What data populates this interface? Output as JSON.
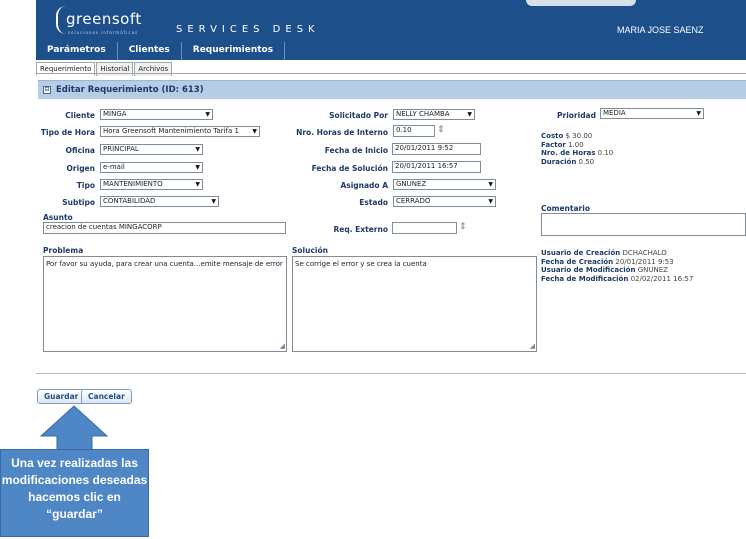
{
  "header": {
    "logo_text": "greensoft",
    "logo_sub": "soluciones informáticas",
    "services_title": "SERVICES DESK",
    "user_name": "MARIA JOSE SAENZ"
  },
  "nav": {
    "items": [
      "Parámetros",
      "Clientes",
      "Requerimientos"
    ]
  },
  "tabs": [
    "Requerimiento",
    "Historial",
    "Archivos"
  ],
  "panel_title": "Editar Requerimiento (ID: 613)",
  "form": {
    "cliente": {
      "label": "Cliente",
      "value": "MINGA"
    },
    "tipo_hora": {
      "label": "Tipo de Hora",
      "value": "Hora Greensoft Mantenimiento Tarifa 1"
    },
    "oficina": {
      "label": "Oficina",
      "value": "PRINCIPAL"
    },
    "origen": {
      "label": "Origen",
      "value": "e-mail"
    },
    "tipo": {
      "label": "Tipo",
      "value": "MANTENIMIENTO"
    },
    "subtipo": {
      "label": "Subtipo",
      "value": "CONTABILIDAD"
    },
    "solicitado_por": {
      "label": "Solicitado Por",
      "value": "NELLY CHAMBA"
    },
    "nro_horas_interno": {
      "label": "Nro. Horas de Interno",
      "value": "0.10"
    },
    "fecha_inicio": {
      "label": "Fecha de Inicio",
      "value": "20/01/2011 9:52"
    },
    "fecha_solucion": {
      "label": "Fecha de Solución",
      "value": "20/01/2011 16:57"
    },
    "asignado_a": {
      "label": "Asignado A",
      "value": "GNUNEZ"
    },
    "estado": {
      "label": "Estado",
      "value": "CERRADO"
    },
    "prioridad": {
      "label": "Prioridad",
      "value": "MEDIA"
    },
    "asunto": {
      "label": "Asunto",
      "value": "creacion de cuentas MINGACORP"
    },
    "req_externo": {
      "label": "Req. Externo",
      "value": ""
    },
    "problema": {
      "label": "Problema",
      "value": "Por favor su ayuda, para crear una cuenta...emite mensaje de error"
    },
    "solucion": {
      "label": "Solución",
      "value": "Se corrige el error y se crea la cuenta"
    },
    "comentario": {
      "label": "Comentario",
      "value": ""
    }
  },
  "summary": {
    "costo_label": "Costo",
    "costo_value": "$ 30.00",
    "factor_label": "Factor",
    "factor_value": "1.00",
    "nro_horas_label": "Nro. de Horas",
    "nro_horas_value": "0.10",
    "duracion_label": "Duración",
    "duracion_value": "0.50"
  },
  "audit": {
    "usuario_creacion_label": "Usuario de Creación",
    "usuario_creacion_value": "DCHACHALO",
    "fecha_creacion_label": "Fecha de Creación",
    "fecha_creacion_value": "20/01/2011 9:53",
    "usuario_modificacion_label": "Usuario de Modificación",
    "usuario_modificacion_value": "GNUNEZ",
    "fecha_modificacion_label": "Fecha de Modificación",
    "fecha_modificacion_value": "02/02/2011 16:57"
  },
  "buttons": {
    "guardar": "Guardar",
    "cancelar": "Cancelar"
  },
  "callout": {
    "text": "Una vez realizadas las modificaciones deseadas hacemos clic en “guardar”"
  },
  "colors": {
    "header_bg": "#1d4f8b",
    "panel_bar": "#b7cde6",
    "callout_bg": "#4f86c6"
  }
}
